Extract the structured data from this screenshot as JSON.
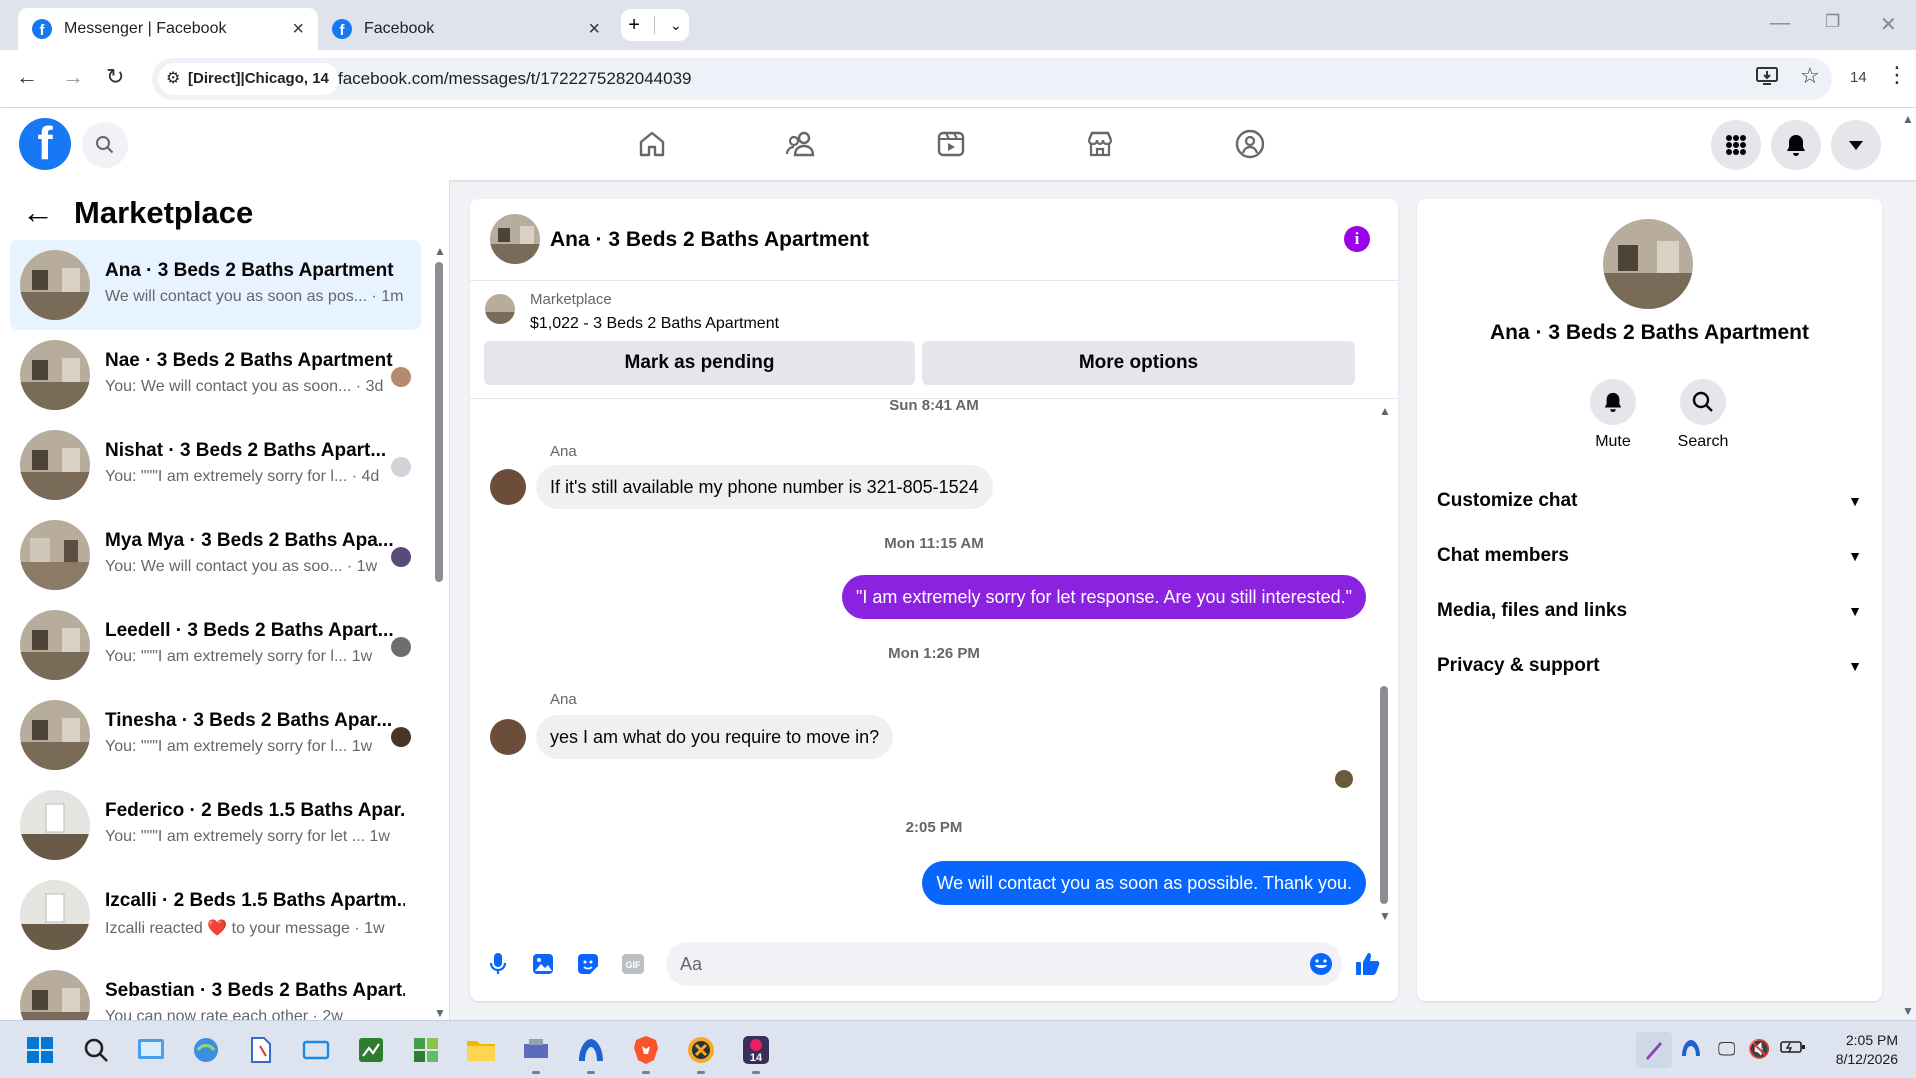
{
  "browser": {
    "tabs": [
      {
        "label": "Messenger | Facebook",
        "active": true
      },
      {
        "label": "Facebook",
        "active": false
      }
    ],
    "site_chip": "[Direct]|Chicago, 14",
    "url": "facebook.com/messages/t/1722275282044039",
    "ext_badge": "14"
  },
  "sidebar": {
    "title": "Marketplace",
    "conversations": [
      {
        "name": "Ana · 3 Beds 2 Baths Apartment",
        "snippet": "We will contact you as soon as pos... · 1m",
        "active": true
      },
      {
        "name": "Nae · 3 Beds 2 Baths Apartment",
        "snippet": "You: We will contact you as soon... · 3d",
        "active": false
      },
      {
        "name": "Nishat · 3 Beds 2 Baths Apart...",
        "snippet": "You: \"\"\"I am extremely sorry for l... · 4d",
        "active": false
      },
      {
        "name": "Mya Mya · 3 Beds 2 Baths Apa...",
        "snippet": "You: We will contact you as soo... · 1w",
        "active": false
      },
      {
        "name": "Leedell · 3 Beds 2 Baths Apart...",
        "snippet": "You: \"\"\"I am extremely sorry for l... 1w",
        "active": false
      },
      {
        "name": "Tinesha · 3 Beds 2 Baths Apar...",
        "snippet": "You: \"\"\"I am extremely sorry for l... 1w",
        "active": false
      },
      {
        "name": "Federico · 2 Beds 1.5 Baths Apar...",
        "snippet": "You: \"\"\"I am extremely sorry for let ... 1w",
        "active": false
      },
      {
        "name": "Izcalli · 2 Beds 1.5 Baths Apartm...",
        "snippet": "Izcalli reacted ❤️ to your message · 1w",
        "active": false
      },
      {
        "name": "Sebastian · 3 Beds 2 Baths Apart...",
        "snippet": "You can now rate each other · 2w",
        "active": false
      }
    ]
  },
  "chat": {
    "title": "Ana · 3 Beds 2 Baths Apartment",
    "marketplace_label": "Marketplace",
    "listing": "$1,022 - 3 Beds 2 Baths Apartment",
    "mark_pending": "Mark as pending",
    "more_options": "More options",
    "ts1": "Sun 8:41 AM",
    "sender1": "Ana",
    "msg1": "If it's still available my phone number is 321-805-1524",
    "ts2": "Mon 11:15 AM",
    "msg2": "\"I am extremely sorry for let response. Are you still interested.\"",
    "ts3": "Mon 1:26 PM",
    "sender2": "Ana",
    "msg3": "yes I am what do you require to move in?",
    "ts4": "2:05 PM",
    "msg4": "We will contact you as soon as possible. Thank you.",
    "composer_placeholder": "Aa",
    "colors": {
      "outgoing_purple": "#8a22e0",
      "outgoing_blue": "#0866ff"
    }
  },
  "info": {
    "name": "Ana · 3 Beds 2 Baths Apartment",
    "mute": "Mute",
    "search": "Search",
    "sections": [
      "Customize chat",
      "Chat members",
      "Media, files and links",
      "Privacy & support"
    ]
  },
  "taskbar": {
    "time": "2:05 PM",
    "date": "8/12/2026"
  }
}
